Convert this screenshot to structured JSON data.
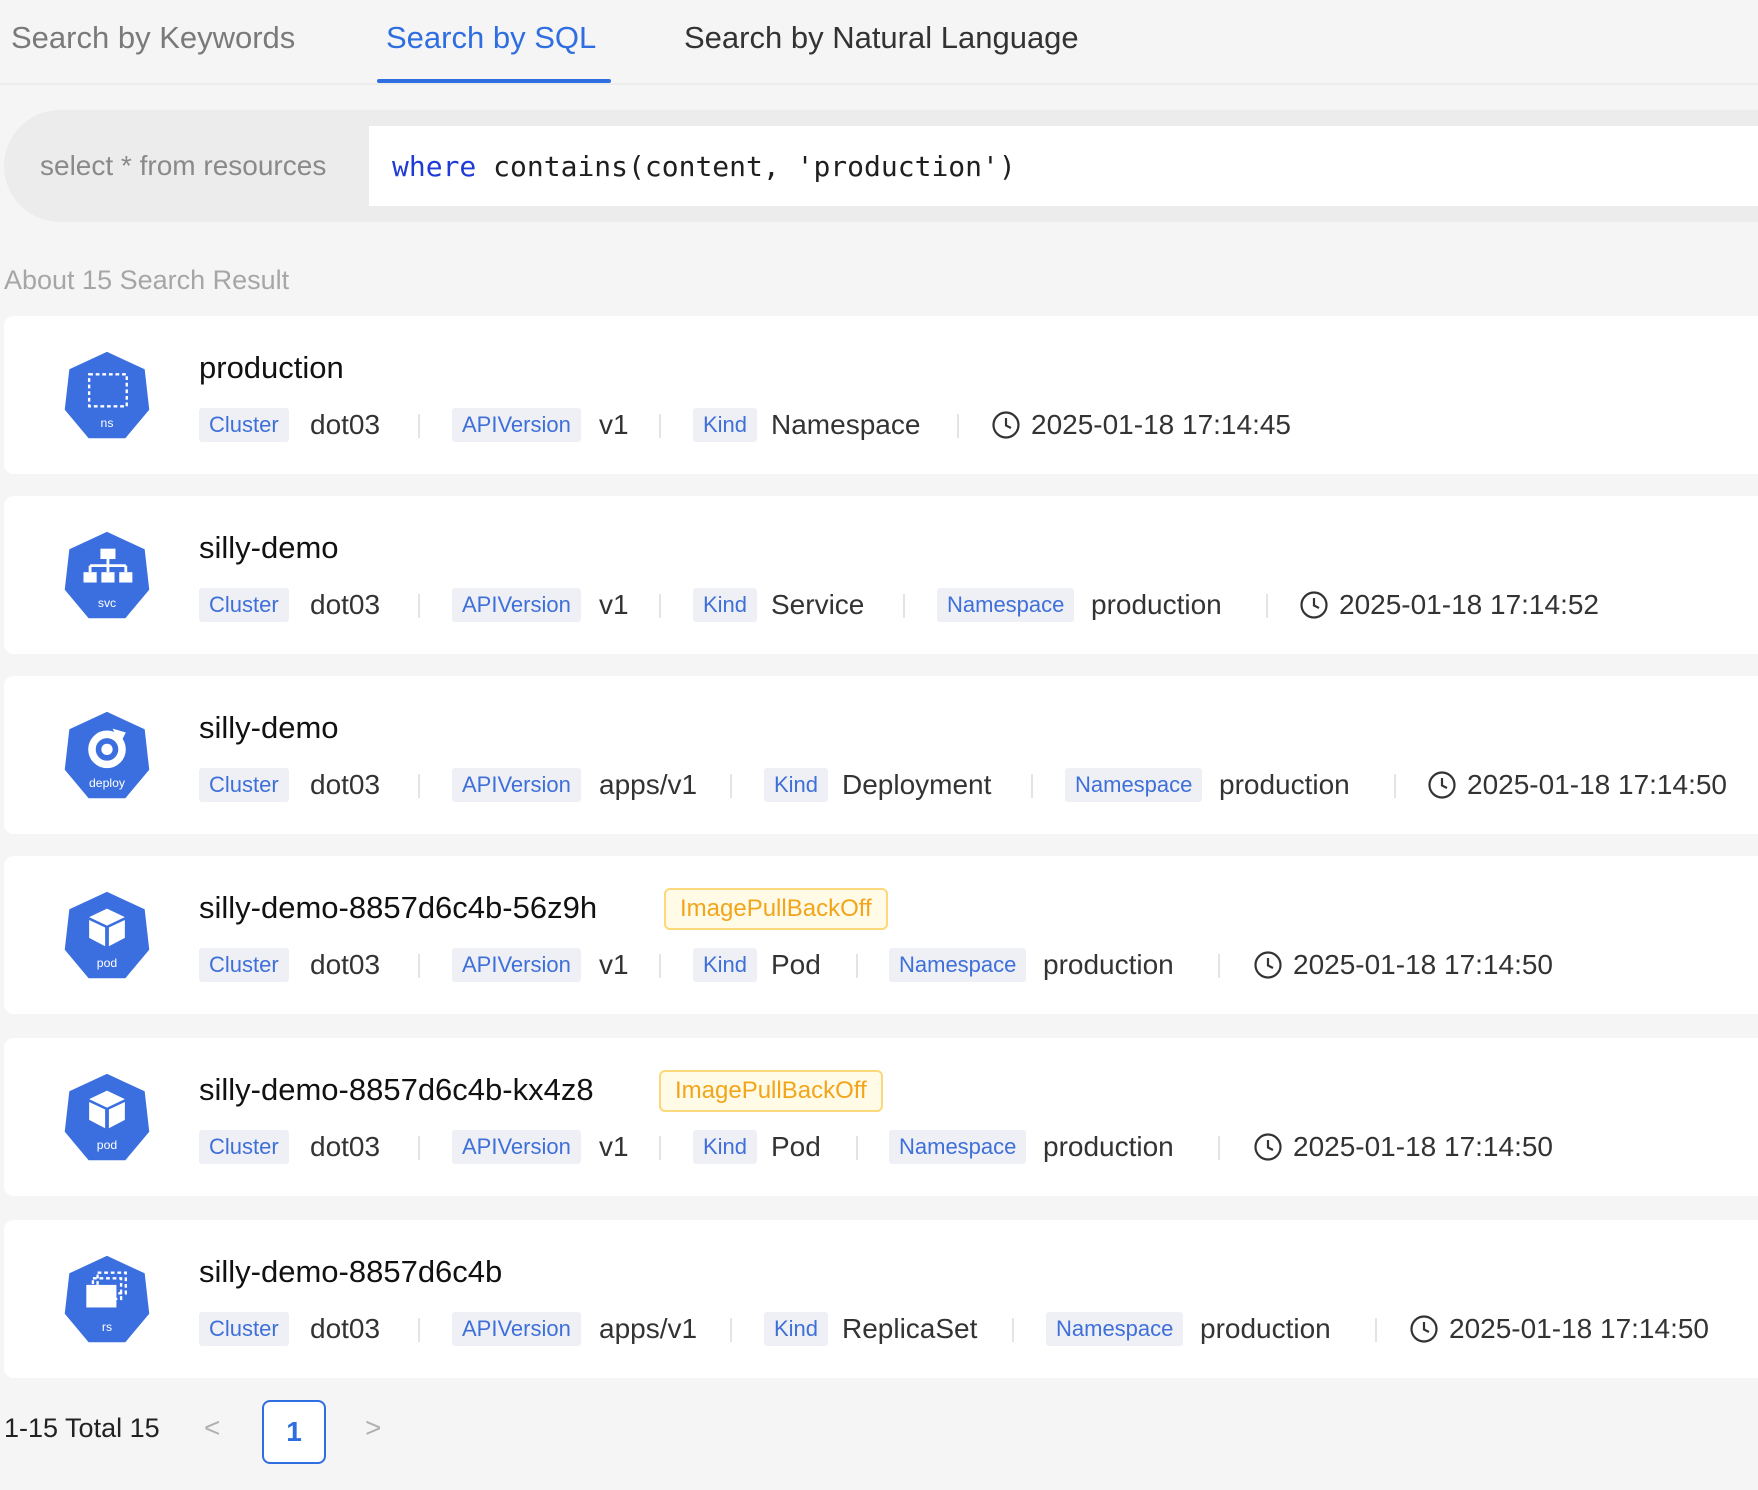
{
  "tabs": [
    {
      "label": "Search by Keywords"
    },
    {
      "label": "Search by SQL"
    },
    {
      "label": "Search by Natural Language"
    }
  ],
  "active_tab": "Search by SQL",
  "query": {
    "prefix": "select * from resources",
    "keyword": "where",
    "expression": " contains(content, 'production')"
  },
  "result_count": "About 15 Search Result",
  "colors": {
    "accent": "#2f6ee0",
    "icon_hex": "#3b6fe0",
    "warning": "#f2a51b"
  },
  "results": [
    {
      "title": "production",
      "icon": "namespace-icon",
      "icon_label": "ns",
      "cluster_label": "Cluster",
      "cluster": "dot03",
      "api_label": "APIVersion",
      "api": "v1",
      "kind_label": "Kind",
      "kind": "Namespace",
      "time": "2025-01-18 17:14:45"
    },
    {
      "title": "silly-demo",
      "icon": "service-icon",
      "icon_label": "svc",
      "cluster_label": "Cluster",
      "cluster": "dot03",
      "api_label": "APIVersion",
      "api": "v1",
      "kind_label": "Kind",
      "kind": "Service",
      "ns_label": "Namespace",
      "namespace": "production",
      "time": "2025-01-18 17:14:52"
    },
    {
      "title": "silly-demo",
      "icon": "deployment-icon",
      "icon_label": "deploy",
      "cluster_label": "Cluster",
      "cluster": "dot03",
      "api_label": "APIVersion",
      "api": "apps/v1",
      "kind_label": "Kind",
      "kind": "Deployment",
      "ns_label": "Namespace",
      "namespace": "production",
      "time": "2025-01-18 17:14:50"
    },
    {
      "title": "silly-demo-8857d6c4b-56z9h",
      "icon": "pod-icon",
      "icon_label": "pod",
      "status": "ImagePullBackOff",
      "cluster_label": "Cluster",
      "cluster": "dot03",
      "api_label": "APIVersion",
      "api": "v1",
      "kind_label": "Kind",
      "kind": "Pod",
      "ns_label": "Namespace",
      "namespace": "production",
      "time": "2025-01-18 17:14:50"
    },
    {
      "title": "silly-demo-8857d6c4b-kx4z8",
      "icon": "pod-icon",
      "icon_label": "pod",
      "status": "ImagePullBackOff",
      "cluster_label": "Cluster",
      "cluster": "dot03",
      "api_label": "APIVersion",
      "api": "v1",
      "kind_label": "Kind",
      "kind": "Pod",
      "ns_label": "Namespace",
      "namespace": "production",
      "time": "2025-01-18 17:14:50"
    },
    {
      "title": "silly-demo-8857d6c4b",
      "icon": "replicaset-icon",
      "icon_label": "rs",
      "cluster_label": "Cluster",
      "cluster": "dot03",
      "api_label": "APIVersion",
      "api": "apps/v1",
      "kind_label": "Kind",
      "kind": "ReplicaSet",
      "ns_label": "Namespace",
      "namespace": "production",
      "time": "2025-01-18 17:14:50"
    }
  ],
  "pagination": {
    "total_text": "1-15 Total 15",
    "prev": "<",
    "next": ">",
    "current_page": "1"
  }
}
